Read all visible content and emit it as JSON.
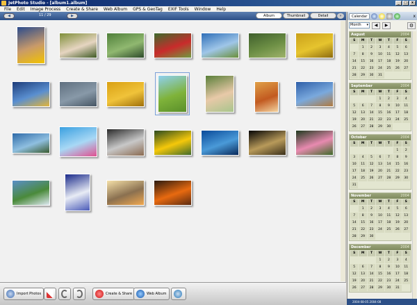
{
  "window": {
    "title": "JetPhoto Studio - [album1.album]",
    "controls": [
      "_",
      "□",
      "x"
    ]
  },
  "menu": [
    "File",
    "Edit",
    "Image Process",
    "Create & Share",
    "Web Album",
    "GPS & GeoTag",
    "EXIF Tools",
    "Window",
    "Help"
  ],
  "toolbar": {
    "prev": "◀",
    "next": "▶",
    "page_count": "11 / 29",
    "tabs": [
      "Album",
      "Thumbnail",
      "Detail"
    ]
  },
  "photos": [
    {
      "name": "boy-portrait",
      "colors": [
        "#2b4b8c",
        "#c89a6a",
        "#f2c200"
      ]
    },
    {
      "name": "kids-on-bench",
      "colors": [
        "#7f8f3a",
        "#e6d5c1",
        "#3f5a25"
      ]
    },
    {
      "name": "pond",
      "colors": [
        "#4f7f3a",
        "#90b870",
        "#2d4a2a"
      ]
    },
    {
      "name": "red-flowers",
      "colors": [
        "#3d6b2d",
        "#c92b2b",
        "#6f9b3f"
      ]
    },
    {
      "name": "tree-sky",
      "colors": [
        "#2f6fb8",
        "#9fc6e8",
        "#6a8f3a"
      ]
    },
    {
      "name": "forest-path",
      "colors": [
        "#3f5f2c",
        "#6d8f45",
        "#9fb36b"
      ]
    },
    {
      "name": "yellow-flowers",
      "colors": [
        "#c9a01a",
        "#e6c42e",
        "#8d6b10"
      ]
    },
    {
      "name": "mountain-lake",
      "colors": [
        "#1d3c7a",
        "#5a8fd0",
        "#e2b43a"
      ]
    },
    {
      "name": "misty-water",
      "colors": [
        "#5f6f7f",
        "#8899a8",
        "#465563"
      ]
    },
    {
      "name": "golden-flowers",
      "colors": [
        "#d9a013",
        "#f0c33a",
        "#9f6f0a"
      ]
    },
    {
      "name": "green-meadow",
      "colors": [
        "#8fd0f0",
        "#7fb33a",
        "#5a8f2a"
      ]
    },
    {
      "name": "baby-portrait",
      "colors": [
        "#5a7f3a",
        "#e8c9a8",
        "#a8c58c"
      ]
    },
    {
      "name": "desert-rock",
      "colors": [
        "#e0a048",
        "#c25a20",
        "#f3d3a0"
      ]
    },
    {
      "name": "dog-silhouette",
      "colors": [
        "#2f5fa8",
        "#7aa9dd",
        "#b07a40"
      ]
    },
    {
      "name": "coastline",
      "colors": [
        "#2e6aa8",
        "#8fbfe0",
        "#3a5a2f"
      ]
    },
    {
      "name": "aquarium-toys",
      "colors": [
        "#3aa0e0",
        "#a8d8f5",
        "#e05090"
      ]
    },
    {
      "name": "baby-with-toys",
      "colors": [
        "#2a2a2a",
        "#c8c8c8",
        "#8a6a50"
      ]
    },
    {
      "name": "yellow-daisy",
      "colors": [
        "#2a4a1f",
        "#f5c80a",
        "#3f6a2a"
      ]
    },
    {
      "name": "blue-tower",
      "colors": [
        "#0a4a9a",
        "#4a9ad8",
        "#0a2a5a"
      ]
    },
    {
      "name": "moon",
      "colors": [
        "#050505",
        "#b89a5a",
        "#3a2f1a"
      ]
    },
    {
      "name": "lotus",
      "colors": [
        "#1f3a1f",
        "#e88ab0",
        "#3f6a2a"
      ]
    },
    {
      "name": "alpine-valley",
      "colors": [
        "#5a8fc8",
        "#4a8a3a",
        "#dde8f0"
      ]
    },
    {
      "name": "statue",
      "colors": [
        "#1a2a8a",
        "#e8ecf5",
        "#4a5ab8"
      ]
    },
    {
      "name": "beach-sunset",
      "colors": [
        "#f5e0a8",
        "#8a7050",
        "#f0a850"
      ]
    },
    {
      "name": "orange-sunset",
      "colors": [
        "#2a1a10",
        "#e86a10",
        "#5a2a10"
      ]
    }
  ],
  "bottom": {
    "import": "Import Photos",
    "create": "Create & Share",
    "web": "Web Album"
  },
  "side": {
    "tab": "Calendar",
    "view_select": "Month",
    "gear": "⚙",
    "close": "x",
    "left_arrow": "◀",
    "right_arrow": "▶",
    "dow": [
      "S",
      "M",
      "T",
      "W",
      "T",
      "F",
      "S"
    ],
    "months": [
      {
        "name": "August",
        "year": "2004",
        "lead": 1,
        "days": 31
      },
      {
        "name": "September",
        "year": "2004",
        "lead": 3,
        "days": 30
      },
      {
        "name": "October",
        "year": "2004",
        "lead": 5,
        "days": 31
      },
      {
        "name": "November",
        "year": "2004",
        "lead": 1,
        "days": 30
      },
      {
        "name": "December",
        "year": "2004",
        "lead": 3,
        "days": 31
      }
    ],
    "status": "2004-08-05 2004-08"
  }
}
